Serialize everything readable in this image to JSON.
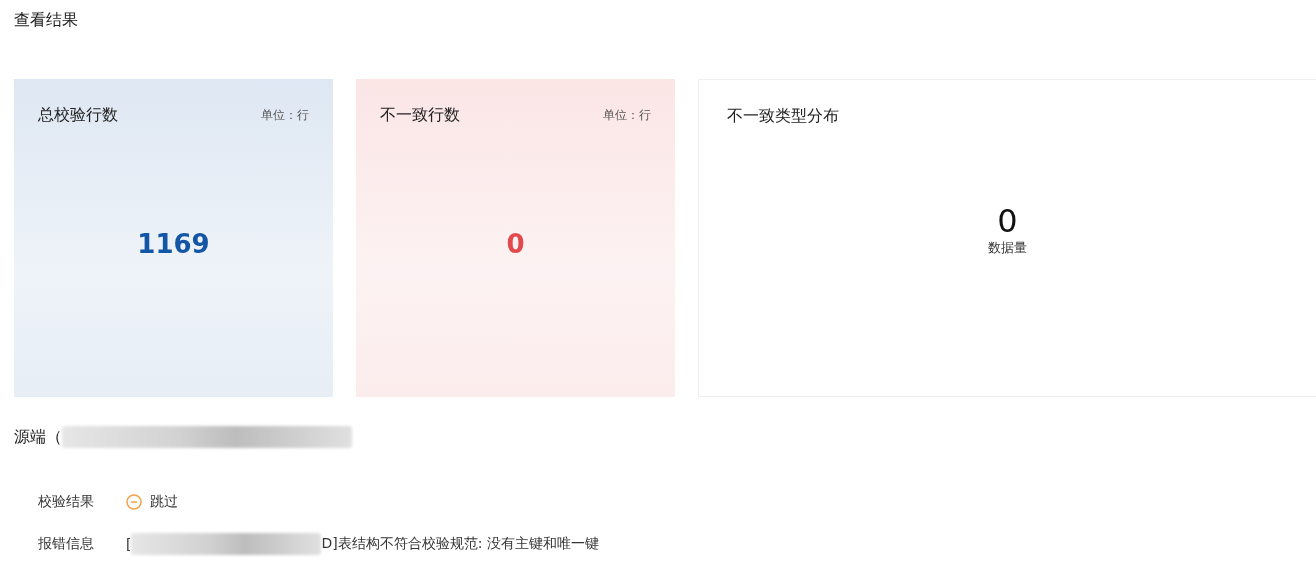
{
  "page_title": "查看结果",
  "cards": [
    {
      "kind": "metric",
      "color": "#1456a6",
      "title": "总校验行数",
      "unit": "单位：行",
      "value": "1169"
    },
    {
      "kind": "metric",
      "color": "#e2494c",
      "title": "不一致行数",
      "unit": "单位：行",
      "value": "0"
    },
    {
      "kind": "distribution",
      "title": "不一致类型分布",
      "value": "0",
      "caption": "数据量"
    }
  ],
  "source": {
    "label": "源端（",
    "redacted": true
  },
  "details": [
    {
      "kind": "status",
      "label": "校验结果",
      "color": "#f0a24a",
      "value": "跳过"
    },
    {
      "kind": "message",
      "label": "报错信息",
      "prefix": "[",
      "redacted": true,
      "suffix": "D]表结构不符合校验规范: 没有主键和唯一键"
    }
  ]
}
